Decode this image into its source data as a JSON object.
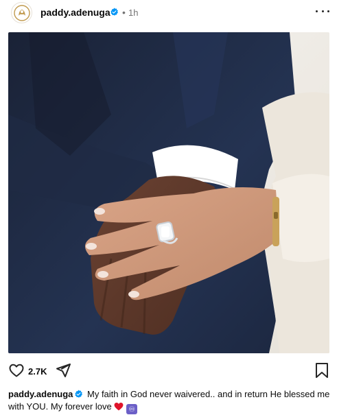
{
  "post": {
    "username": "paddy.adenuga",
    "separator": "•",
    "time_ago": "1h",
    "more_icon": "more-horizontal-icon",
    "verified_color": "#0095f6"
  },
  "media": {
    "photo_colors": {
      "suit": "#1d2a44",
      "sweater": "#efe9e0",
      "wall": "#f4f2ee"
    }
  },
  "actions": {
    "like_icon": "heart-outline-icon",
    "likes_count": "2.7K",
    "share_icon": "paper-plane-icon",
    "save_icon": "bookmark-icon"
  },
  "caption": {
    "username": "paddy.adenuga",
    "text": " My faith in God never waivered.. and in return He blessed me with YOU. My forever love ",
    "heart_emoji": "red-heart-emoji",
    "infinity_emoji": "♾"
  }
}
